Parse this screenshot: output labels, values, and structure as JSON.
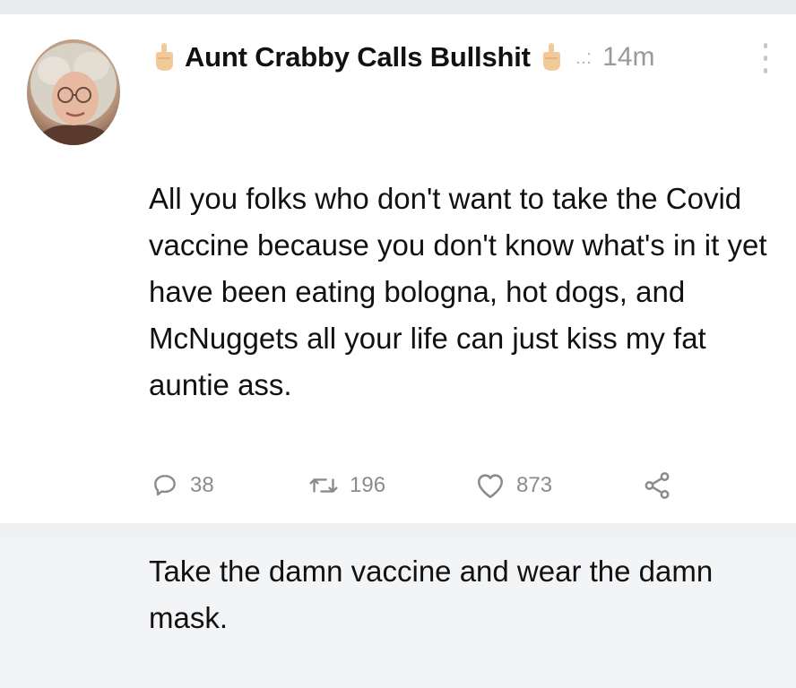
{
  "tweet": {
    "author_name": "Aunt Crabby Calls Bullshit",
    "timestamp": "14m",
    "paragraphs": [
      "All you folks who don't want to take the Covid vaccine because you don't know what's in it yet have been eating bologna, hot dogs, and McNuggets all your life can just kiss my fat auntie ass.",
      "Take the damn vaccine and wear the damn mask."
    ]
  },
  "actions": {
    "reply_count": "38",
    "retweet_count": "196",
    "like_count": "873"
  },
  "icons": {
    "name_prefix": "middle-finger-emoji-icon",
    "name_suffix": "middle-finger-emoji-icon",
    "reply": "reply-icon",
    "retweet": "retweet-icon",
    "like": "heart-icon",
    "share": "share-icon",
    "more": "more-vertical-icon"
  },
  "colors": {
    "text": "#111111",
    "muted": "#8b8b8b",
    "background": "#ffffff"
  }
}
